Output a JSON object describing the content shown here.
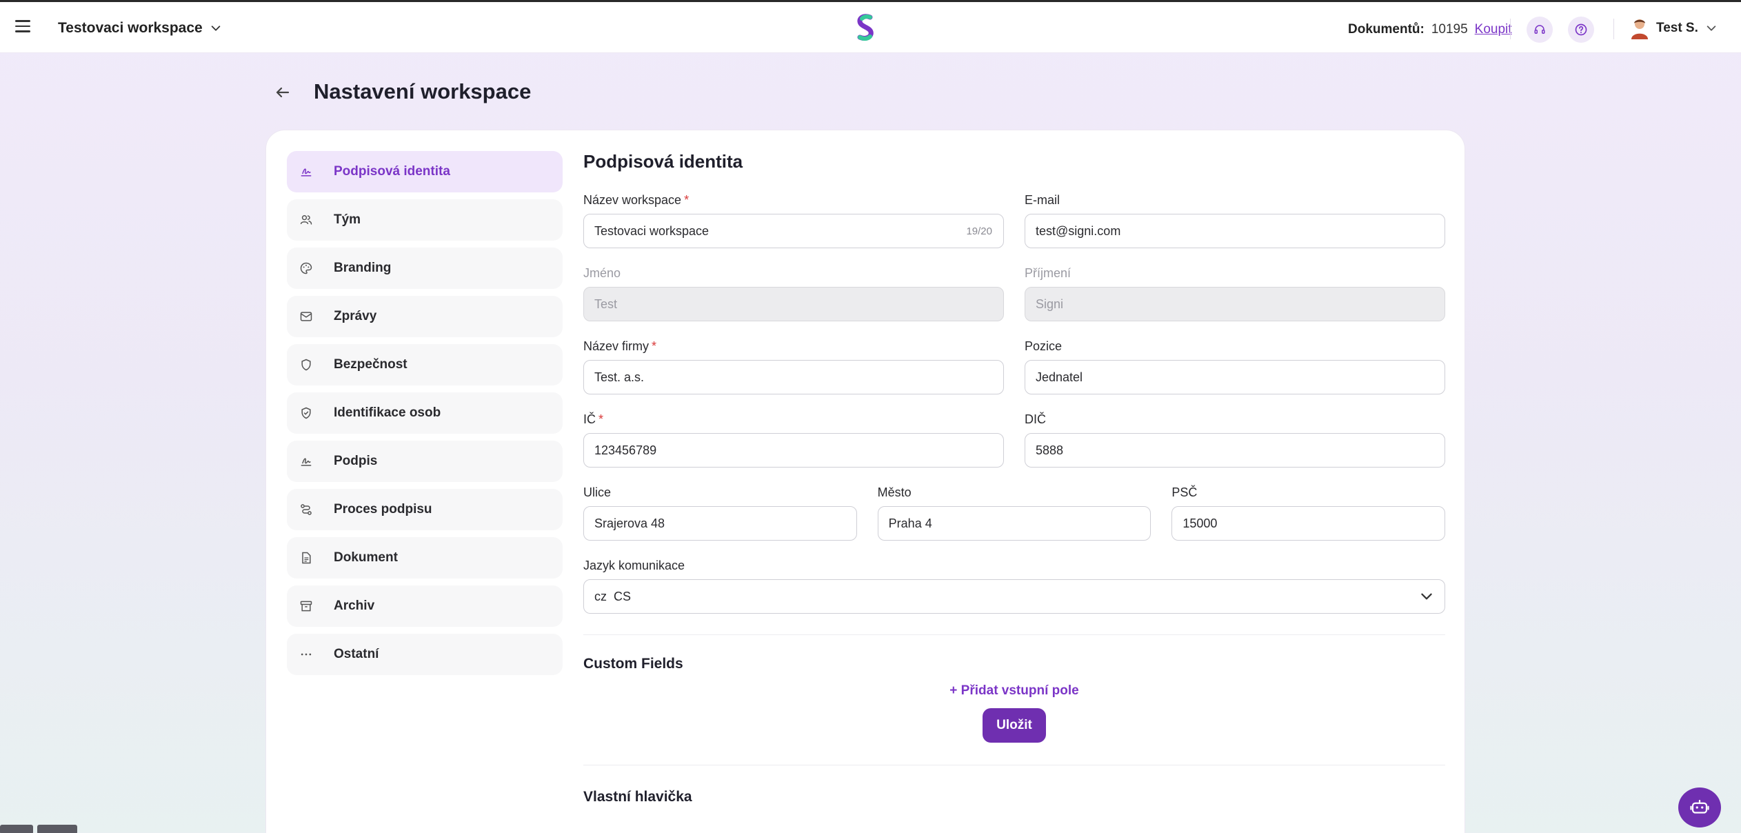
{
  "header": {
    "workspace_name": "Testovaci workspace",
    "documents_label": "Dokumentů:",
    "documents_count": "10195",
    "buy_link": "Koupit",
    "user_name": "Test S."
  },
  "page": {
    "title": "Nastavení workspace"
  },
  "nav": {
    "items": [
      {
        "label": "Podpisová identita",
        "icon": "signature-icon",
        "active": true
      },
      {
        "label": "Tým",
        "icon": "users-icon"
      },
      {
        "label": "Branding",
        "icon": "palette-icon"
      },
      {
        "label": "Zprávy",
        "icon": "mail-icon"
      },
      {
        "label": "Bezpečnost",
        "icon": "shield-icon"
      },
      {
        "label": "Identifikace osob",
        "icon": "shield-check-icon"
      },
      {
        "label": "Podpis",
        "icon": "signature-icon"
      },
      {
        "label": "Proces podpisu",
        "icon": "route-icon"
      },
      {
        "label": "Dokument",
        "icon": "document-icon"
      },
      {
        "label": "Archiv",
        "icon": "archive-icon"
      },
      {
        "label": "Ostatní",
        "icon": "more-icon"
      }
    ]
  },
  "form": {
    "section_title": "Podpisová identita",
    "workspace_name": {
      "label": "Název workspace",
      "value": "Testovaci workspace",
      "counter": "19/20"
    },
    "email": {
      "label": "E-mail",
      "value": "test@signi.com"
    },
    "first_name": {
      "label": "Jméno",
      "value": "Test"
    },
    "last_name": {
      "label": "Příjmení",
      "value": "Signi"
    },
    "company": {
      "label": "Název firmy",
      "value": "Test. a.s."
    },
    "position": {
      "label": "Pozice",
      "value": "Jednatel"
    },
    "ic": {
      "label": "IČ",
      "value": "123456789"
    },
    "dic": {
      "label": "DIČ",
      "value": "5888"
    },
    "street": {
      "label": "Ulice",
      "value": "Srajerova 48"
    },
    "city": {
      "label": "Město",
      "value": "Praha 4"
    },
    "zip": {
      "label": "PSČ",
      "value": "15000"
    },
    "language": {
      "label": "Jazyk komunikace",
      "flag": "cz",
      "value": "CS"
    },
    "required_mark": "*"
  },
  "custom_fields": {
    "title": "Custom Fields",
    "add_label": "+ Přidat vstupní pole",
    "save_label": "Uložit"
  },
  "header_section": {
    "title": "Vlastní hlavička"
  },
  "colors": {
    "accent": "#6f2fb0",
    "link": "#7b35c7",
    "active_nav_bg": "#f0e6fb"
  }
}
